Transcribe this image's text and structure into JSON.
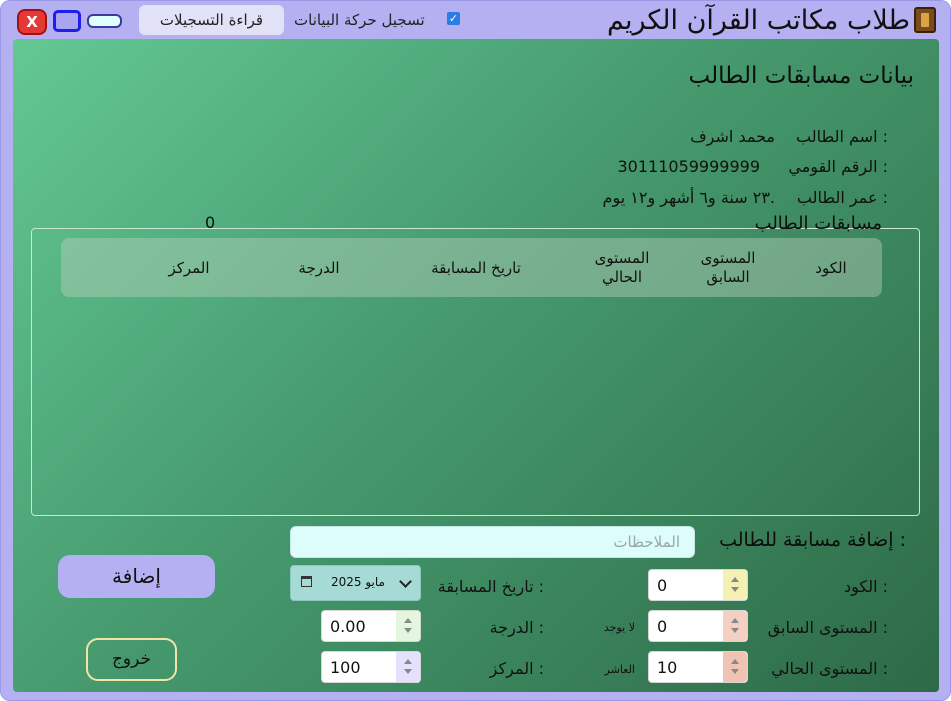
{
  "window": {
    "title": "طلاب مكاتب القرآن الكريم",
    "close_label": "X",
    "records_button": "قراءة التسجيلات",
    "log_checkbox_label": "تسجيل حركة البيانات",
    "log_checkbox_mark": "✓",
    "log_checked": true
  },
  "heading": "بيانات مسابقات الطالب",
  "student": {
    "name_label": "اسم الطالب :",
    "name_value": "محمد اشرف",
    "national_id_label": "الرقم القومي :",
    "national_id_value": "30111059999999",
    "age_label": "عمر الطالب :",
    "age_value": "٢٣ سنة و٦ أشهر و١٢ يوم."
  },
  "competitions": {
    "group_title": "مسابقات الطالب",
    "count": "0",
    "columns": {
      "code": "الكود",
      "prev_level": "المستوى السابق",
      "current_level": "المستوى الحالي",
      "date": "تاريخ المسابقة",
      "grade": "الدرجة",
      "rank": "المركز"
    },
    "rows": []
  },
  "add_form": {
    "title": "إضافة مسابقة للطالب :",
    "notes_placeholder": "الملاحظات",
    "code_label": "الكود :",
    "code_value": "0",
    "prev_level_label": "المستوى السابق :",
    "prev_level_value": "0",
    "prev_level_note": "لا يوجد",
    "current_level_label": "المستوى الحالي :",
    "current_level_value": "10",
    "current_level_note": "العاشر",
    "date_label": "تاريخ المسابقة :",
    "date_value": "مايو 2025",
    "grade_label": "الدرجة :",
    "grade_value": "0.00",
    "rank_label": "المركز :",
    "rank_value": "100",
    "add_button": "إضافة",
    "exit_button": "خروج"
  },
  "colors": {
    "window_bg": "#b4b0f2",
    "panel_gradient_start": "#63c893",
    "panel_gradient_end": "#2d6a47",
    "close_red": "#e53935",
    "notes_bg": "#dcfdfc"
  }
}
